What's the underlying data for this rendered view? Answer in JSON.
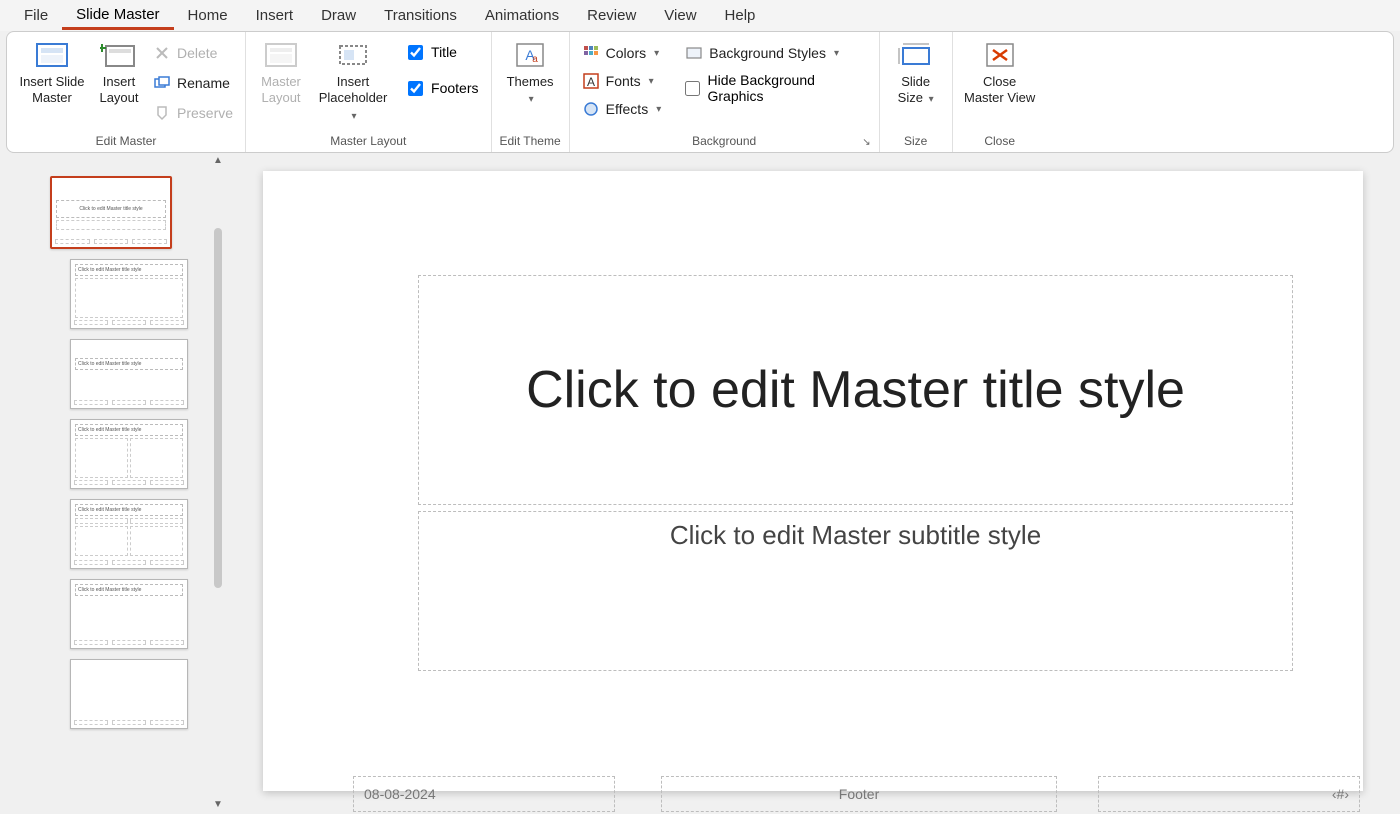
{
  "tabs": [
    "File",
    "Slide Master",
    "Home",
    "Insert",
    "Draw",
    "Transitions",
    "Animations",
    "Review",
    "View",
    "Help"
  ],
  "active_tab_index": 1,
  "ribbon": {
    "edit_master": {
      "label": "Edit Master",
      "insert_slide_master": "Insert Slide Master",
      "insert_layout": "Insert Layout",
      "delete": "Delete",
      "rename": "Rename",
      "preserve": "Preserve"
    },
    "master_layout": {
      "label": "Master Layout",
      "master_layout_btn": "Master Layout",
      "insert_placeholder": "Insert Placeholder",
      "title_ck": "Title",
      "footers_ck": "Footers",
      "title_checked": true,
      "footers_checked": true
    },
    "edit_theme": {
      "label": "Edit Theme",
      "themes": "Themes"
    },
    "background": {
      "label": "Background",
      "colors": "Colors",
      "fonts": "Fonts",
      "effects": "Effects",
      "bg_styles": "Background Styles",
      "hide_bg": "Hide Background Graphics",
      "hide_bg_checked": false
    },
    "size": {
      "label": "Size",
      "slide_size": "Slide Size"
    },
    "close": {
      "label": "Close",
      "close_master": "Close Master View"
    }
  },
  "slide": {
    "title_placeholder": "Click to edit Master title style",
    "subtitle_placeholder": "Click to edit Master subtitle style",
    "date": "08-08-2024",
    "footer": "Footer",
    "slide_number": "‹#›"
  },
  "thumbs": {
    "master_text": "Click to edit Master title style",
    "layout_text": "Click to edit Master title style"
  }
}
